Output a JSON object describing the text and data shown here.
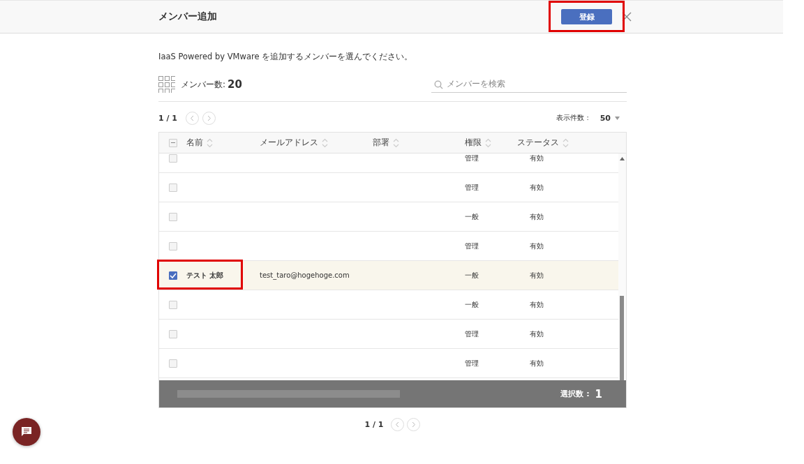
{
  "header": {
    "title": "メンバー追加",
    "submit_label": "登録"
  },
  "description": "IaaS Powered by VMware を追加するメンバーを選んでください。",
  "summary": {
    "label": "メンバー数:",
    "count": "20"
  },
  "search": {
    "placeholder": "メンバーを検索"
  },
  "top_pager": {
    "page": "1 / 1",
    "per_page_label": "表示件数 :",
    "per_page": "50"
  },
  "table": {
    "select_all": {
      "indeterminate": true
    },
    "columns": [
      "名前",
      "メールアドレス",
      "部署",
      "権限",
      "ステータス"
    ],
    "rows": [
      {
        "checked": false,
        "name": "",
        "email": "",
        "role": "管理",
        "status": "有効"
      },
      {
        "checked": false,
        "name": "",
        "email": "",
        "role": "管理",
        "status": "有効"
      },
      {
        "checked": false,
        "name": "",
        "email": "",
        "role": "一般",
        "status": "有効"
      },
      {
        "checked": false,
        "name": "",
        "email": "",
        "role": "管理",
        "status": "有効"
      },
      {
        "checked": true,
        "name": "テスト 太郎",
        "email": "test_taro@hogehoge.com",
        "role": "一般",
        "status": "有効"
      },
      {
        "checked": false,
        "name": "",
        "email": "",
        "role": "一般",
        "status": "有効"
      },
      {
        "checked": false,
        "name": "",
        "email": "",
        "role": "管理",
        "status": "有効"
      },
      {
        "checked": false,
        "name": "",
        "email": "",
        "role": "管理",
        "status": "有効"
      }
    ]
  },
  "selection_bar": {
    "label": "選択数 :",
    "count": "1"
  },
  "bottom_pager": {
    "page": "1 / 1"
  }
}
